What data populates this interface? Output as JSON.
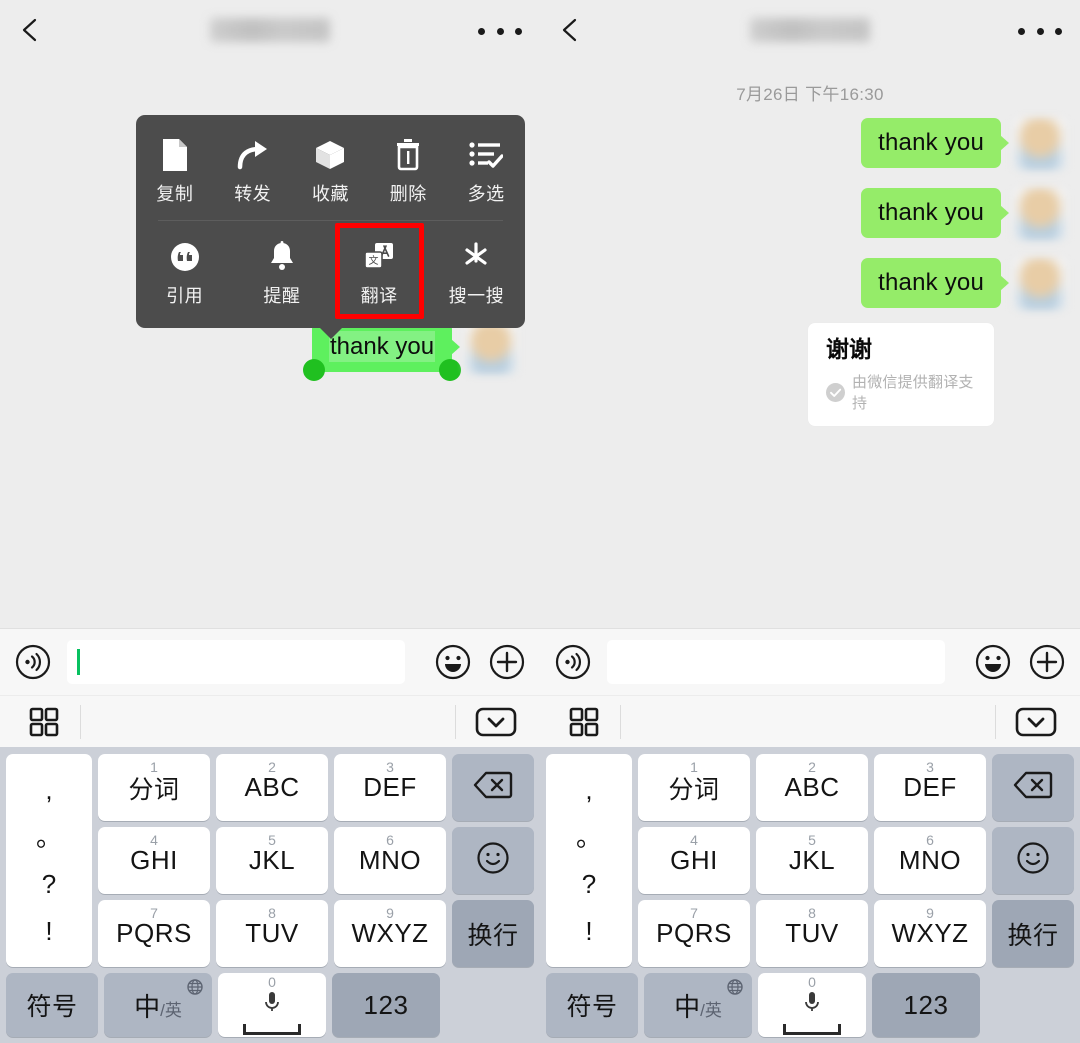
{
  "app": {
    "name": "WeChat",
    "accent_green": "#95ec69",
    "selection_green": "#5ef05e",
    "highlight_red": "#ff0000",
    "menu_bg": "#4c4c4c",
    "chat_bg": "#ededed",
    "keyboard_bg": "#ccd0d8"
  },
  "navbar": {
    "back_icon": "chevron-left-icon",
    "title": "",
    "more_icon": "more-dots-icon"
  },
  "left_panel": {
    "context_menu": {
      "row1": [
        {
          "label": "复制",
          "icon": "copy-document-icon",
          "highlighted": false
        },
        {
          "label": "转发",
          "icon": "forward-arrow-icon",
          "highlighted": false
        },
        {
          "label": "收藏",
          "icon": "favorite-box-icon",
          "highlighted": false
        },
        {
          "label": "删除",
          "icon": "trash-icon",
          "highlighted": false
        },
        {
          "label": "多选",
          "icon": "multi-select-icon",
          "highlighted": false
        }
      ],
      "row2": [
        {
          "label": "引用",
          "icon": "quote-icon",
          "highlighted": false
        },
        {
          "label": "提醒",
          "icon": "bell-reminder-icon",
          "highlighted": false
        },
        {
          "label": "翻译",
          "icon": "translate-icon",
          "highlighted": true
        },
        {
          "label": "搜一搜",
          "icon": "search-star-icon",
          "highlighted": false
        }
      ]
    },
    "selected_message": {
      "text": "thank you",
      "selected": true
    }
  },
  "right_panel": {
    "daystamp": "7月26日 下午16:30",
    "messages": [
      {
        "text": "thank you",
        "side": "outgoing"
      },
      {
        "text": "thank you",
        "side": "outgoing"
      },
      {
        "text": "thank you",
        "side": "outgoing"
      }
    ],
    "translation_card": {
      "translated_text": "谢谢",
      "footer": "由微信提供翻译支持",
      "footer_icon": "check-circle-icon"
    }
  },
  "input_bar": {
    "voice_icon": "voice-wave-icon",
    "text_value": "",
    "placeholder": "",
    "emoji_icon": "emoji-smile-icon",
    "plus_icon": "plus-circle-icon"
  },
  "toolbar": {
    "grid_icon": "grid-panel-icon",
    "candidates": [],
    "hide_keyboard_icon": "chevron-down-box-icon"
  },
  "keyboard": {
    "punctuation": [
      ",",
      "。",
      "?",
      "!"
    ],
    "rows": [
      [
        {
          "sup": "1",
          "main": "分词"
        },
        {
          "sup": "2",
          "main": "ABC"
        },
        {
          "sup": "3",
          "main": "DEF"
        }
      ],
      [
        {
          "sup": "4",
          "main": "GHI"
        },
        {
          "sup": "5",
          "main": "JKL"
        },
        {
          "sup": "6",
          "main": "MNO"
        }
      ],
      [
        {
          "sup": "7",
          "main": "PQRS"
        },
        {
          "sup": "8",
          "main": "TUV"
        },
        {
          "sup": "9",
          "main": "WXYZ"
        }
      ]
    ],
    "right_column": [
      {
        "label": "",
        "icon": "backspace-icon"
      },
      {
        "label": "",
        "icon": "emoji-smile-icon"
      },
      {
        "label": "换行",
        "icon": ""
      }
    ],
    "bottom_row": {
      "symbols": "符号",
      "lang_main": "中",
      "lang_sub": "/英",
      "globe_icon": "globe-icon",
      "space_sup": "0",
      "space_icon": "microphone-icon",
      "numeric": "123"
    }
  }
}
